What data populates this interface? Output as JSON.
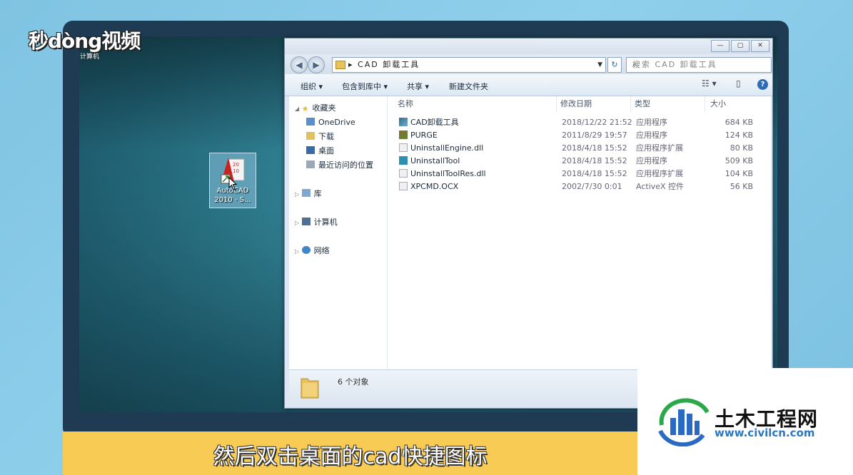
{
  "brand": {
    "logo_text": "秒dòng视频",
    "logo_sub": "计算机"
  },
  "desktop_icon": {
    "label_line1": "AutoCAD",
    "label_line2": "2010 - S..."
  },
  "window": {
    "address": {
      "path": "CAD 卸载工具",
      "sep": "▸"
    },
    "search_placeholder": "搜索 CAD 卸载工具",
    "toolbar": {
      "organize": "组织 ▾",
      "include_library": "包含到库中 ▾",
      "share": "共享 ▾",
      "new_folder": "新建文件夹"
    },
    "nav": {
      "favorites": "收藏夹",
      "onedrive": "OneDrive",
      "downloads": "下载",
      "desktop": "桌面",
      "recent": "最近访问的位置",
      "libraries": "库",
      "computer": "计算机",
      "network": "网络"
    },
    "columns": {
      "name": "名称",
      "modified": "修改日期",
      "type": "类型",
      "size": "大小"
    },
    "files": [
      {
        "name": "CAD卸载工具",
        "modified": "2018/12/22 21:52",
        "type": "应用程序",
        "size": "684 KB",
        "icon": "cad-uninstall-icon"
      },
      {
        "name": "PURGE",
        "modified": "2011/8/29 19:57",
        "type": "应用程序",
        "size": "124 KB",
        "icon": "purge-icon"
      },
      {
        "name": "UninstallEngine.dll",
        "modified": "2018/4/18 15:52",
        "type": "应用程序扩展",
        "size": "80 KB",
        "icon": "dll-icon"
      },
      {
        "name": "UninstallTool",
        "modified": "2018/4/18 15:52",
        "type": "应用程序",
        "size": "509 KB",
        "icon": "uninstall-tool-icon"
      },
      {
        "name": "UninstallToolRes.dll",
        "modified": "2018/4/18 15:52",
        "type": "应用程序扩展",
        "size": "104 KB",
        "icon": "dll-icon"
      },
      {
        "name": "XPCMD.OCX",
        "modified": "2002/7/30 0:01",
        "type": "ActiveX 控件",
        "size": "56 KB",
        "icon": "ocx-icon"
      }
    ],
    "status": "6 个对象"
  },
  "caption": "然后双击桌面的cad快捷图标",
  "watermark": {
    "name": "土木工程网",
    "url": "www.civilcn.com"
  },
  "colors": {
    "caption_bg": "#f8cb55",
    "monitor_bezel": "#1f3a53",
    "link_blue": "#2a78c2"
  }
}
